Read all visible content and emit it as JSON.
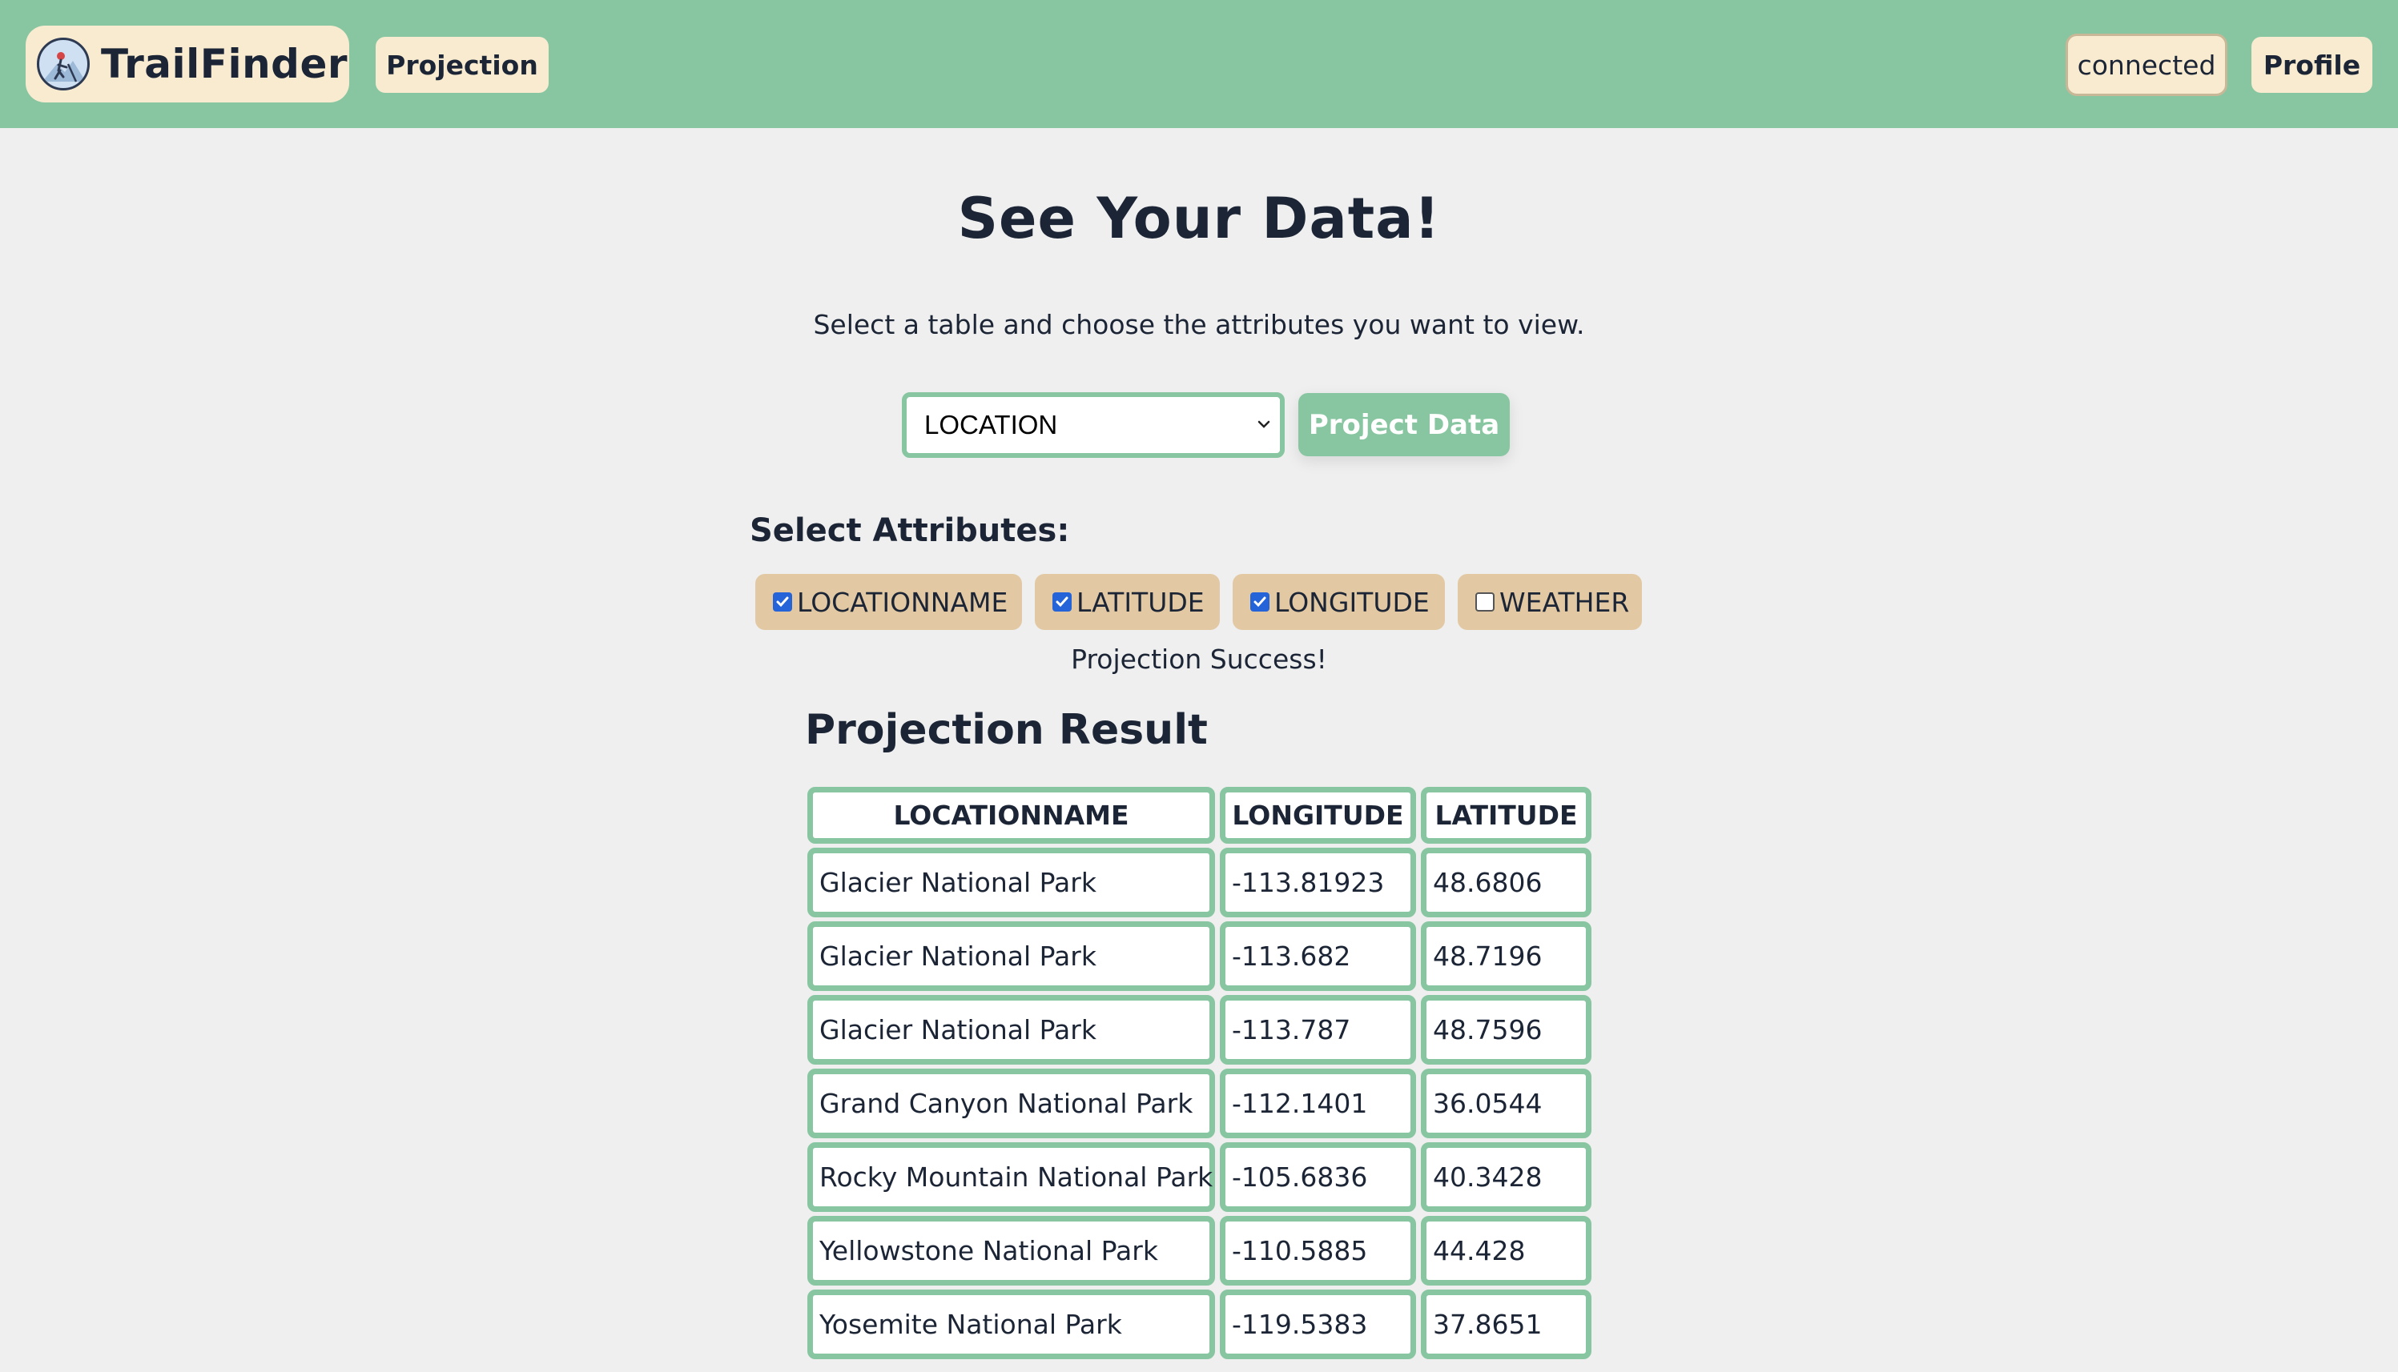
{
  "navbar": {
    "brand": "TrailFinder",
    "projection_link": "Projection",
    "connection_status": "connected",
    "profile_link": "Profile"
  },
  "page": {
    "title": "See Your Data!",
    "subtitle": "Select a table and choose the attributes you want to view."
  },
  "controls": {
    "table_select_value": "LOCATION",
    "project_button": "Project Data"
  },
  "attributes": {
    "heading": "Select Attributes:",
    "items": [
      {
        "label": "LOCATIONNAME",
        "checked": true
      },
      {
        "label": "LATITUDE",
        "checked": true
      },
      {
        "label": "LONGITUDE",
        "checked": true
      },
      {
        "label": "WEATHER",
        "checked": false
      }
    ]
  },
  "status_message": "Projection Success!",
  "result": {
    "title": "Projection Result",
    "columns": [
      "LOCATIONNAME",
      "LONGITUDE",
      "LATITUDE"
    ],
    "rows": [
      [
        "Glacier National Park",
        "-113.81923",
        "48.6806"
      ],
      [
        "Glacier National Park",
        "-113.682",
        "48.7196"
      ],
      [
        "Glacier National Park",
        "-113.787",
        "48.7596"
      ],
      [
        "Grand Canyon National Park",
        "-112.1401",
        "36.0544"
      ],
      [
        "Rocky Mountain National Park",
        "-105.6836",
        "40.3428"
      ],
      [
        "Yellowstone National Park",
        "-110.5885",
        "44.428"
      ],
      [
        "Yosemite National Park",
        "-119.5383",
        "37.8651"
      ]
    ]
  },
  "icons": {
    "logo": "hiker-logo-icon",
    "select_arrow": "chevron-down-icon",
    "checkbox_checked": "checkmark-icon"
  },
  "colors": {
    "navbar": "#88c6a1",
    "cream": "#f8ebd0",
    "chip": "#e2c9a4",
    "accent_green": "#88c6a1",
    "checkbox_blue": "#2464d8",
    "text": "#1c2535",
    "page_bg": "#efefef"
  }
}
